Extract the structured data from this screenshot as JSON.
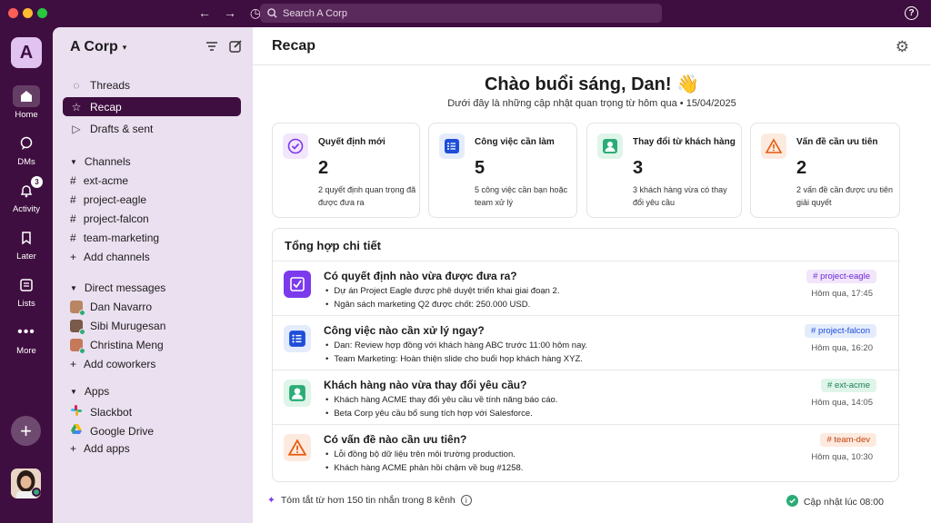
{
  "titlebar": {
    "search_placeholder": "Search A Corp",
    "help": "?"
  },
  "rail": {
    "workspace_initial": "A",
    "items": [
      {
        "label": "Home"
      },
      {
        "label": "DMs"
      },
      {
        "label": "Activity",
        "badge": "3"
      },
      {
        "label": "Later"
      },
      {
        "label": "Lists"
      },
      {
        "label": "More"
      }
    ],
    "add": "+"
  },
  "sidebar": {
    "workspace": "A Corp",
    "nav": [
      {
        "label": "Threads"
      },
      {
        "label": "Recap"
      },
      {
        "label": "Drafts & sent"
      }
    ],
    "channels_header": "Channels",
    "channels": [
      "ext-acme",
      "project-eagle",
      "project-falcon",
      "team-marketing"
    ],
    "add_channels": "Add channels",
    "dm_header": "Direct messages",
    "dms": [
      "Dan Navarro",
      "Sibi Murugesan",
      "Christina Meng"
    ],
    "add_coworkers": "Add coworkers",
    "apps_header": "Apps",
    "apps": [
      "Slackbot",
      "Google Drive"
    ],
    "add_apps": "Add apps"
  },
  "main": {
    "title": "Recap",
    "greeting": "Chào buổi sáng, Dan! 👋",
    "subtitle": "Dưới đây là những cập nhật quan trọng từ hôm qua • 15/04/2025",
    "cards": [
      {
        "title": "Quyết định mới",
        "number": "2",
        "desc": "2 quyết định quan trọng đã được đưa ra"
      },
      {
        "title": "Công việc cần làm",
        "number": "5",
        "desc": "5 công việc cần bạn hoặc team xử lý"
      },
      {
        "title": "Thay đổi từ khách hàng",
        "number": "3",
        "desc": "3 khách hàng vừa có thay đổi yêu cầu"
      },
      {
        "title": "Vấn đề cần ưu tiên",
        "number": "2",
        "desc": "2 vấn đề cần được ưu tiên giải quyết"
      }
    ],
    "detail_title": "Tổng hợp chi tiết",
    "rows": [
      {
        "q": "Có quyết định nào vừa được đưa ra?",
        "b1": "Dự án Project Eagle được phê duyệt triển khai giai đoạn 2.",
        "b2": "Ngân sách marketing Q2 được chốt: 250.000 USD.",
        "tag": "# project-eagle",
        "time": "Hôm qua, 17:45"
      },
      {
        "q": "Công việc nào cần xử lý ngay?",
        "b1": "Dan: Review hợp đồng với khách hàng ABC trước 11:00 hôm nay.",
        "b2": "Team Marketing: Hoàn thiện slide cho buổi họp khách hàng XYZ.",
        "tag": "# project-falcon",
        "time": "Hôm qua, 16:20"
      },
      {
        "q": "Khách hàng nào vừa thay đổi yêu cầu?",
        "b1": "Khách hàng ACME thay đổi yêu cầu về tính năng báo cáo.",
        "b2": "Beta Corp yêu cầu bổ sung tích hợp với Salesforce.",
        "tag": "# ext-acme",
        "time": "Hôm qua, 14:05"
      },
      {
        "q": "Có vấn đề nào cần ưu tiên?",
        "b1": "Lỗi đồng bộ dữ liệu trên môi trường production.",
        "b2": "Khách hàng ACME phản hồi chậm về bug #1258.",
        "tag": "# team-dev",
        "time": "Hôm qua, 10:30"
      }
    ],
    "footer_left": "Tóm tắt từ hơn 150 tin nhắn trong 8 kênh",
    "footer_right": "Cập nhật lúc 08:00"
  },
  "colors": {
    "aubergine": "#3f0e40",
    "purple": "#7c3aed",
    "blue": "#1d4ed8",
    "green": "#2bac76",
    "orange": "#e8590c"
  }
}
